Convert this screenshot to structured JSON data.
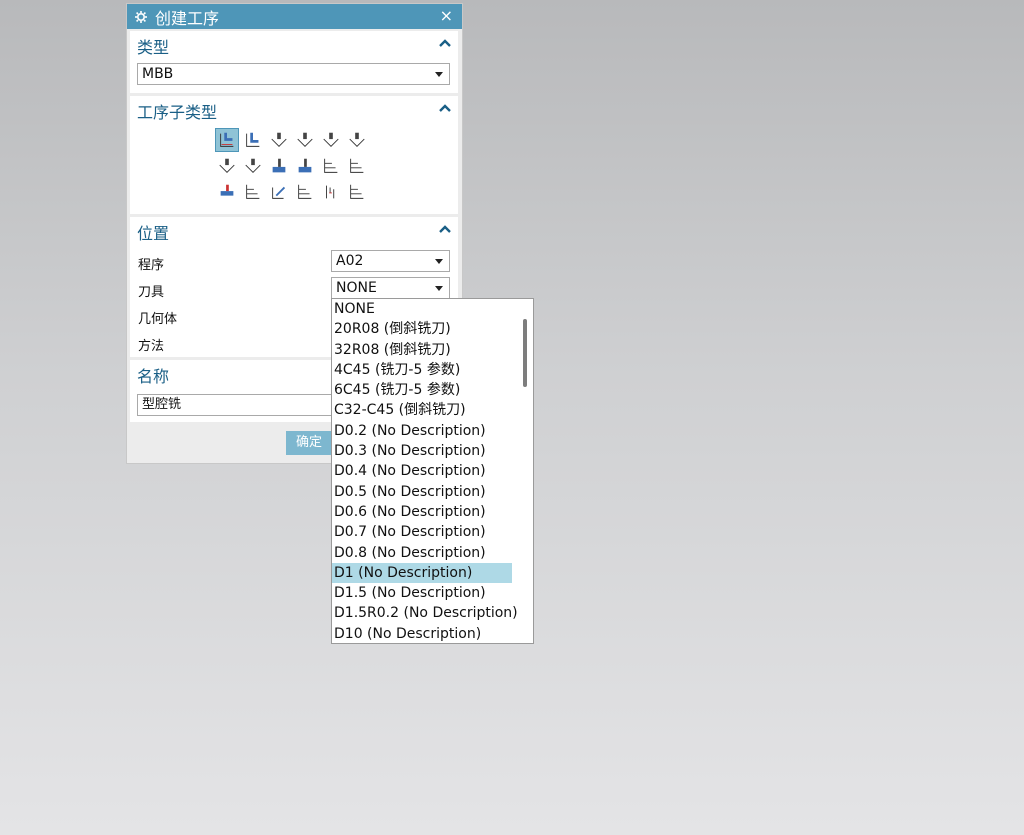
{
  "dialog": {
    "title": "创建工序",
    "close_label": "×",
    "title_icon": "gear-icon"
  },
  "type_section": {
    "heading": "类型",
    "value": "MBB"
  },
  "subtype_section": {
    "heading": "工序子类型",
    "selected_index": 0
  },
  "location_section": {
    "heading": "位置",
    "program_label": "程序",
    "program_value": "A02",
    "tool_label": "刀具",
    "tool_value": "NONE",
    "geometry_label": "几何体",
    "method_label": "方法"
  },
  "name_section": {
    "heading": "名称",
    "value": "型腔铣"
  },
  "buttons": {
    "ok_label": "确定"
  },
  "tool_dropdown": {
    "selected_index": 13,
    "items": [
      "NONE",
      "20R08 (倒斜铣刀)",
      "32R08 (倒斜铣刀)",
      "4C45 (铣刀-5 参数)",
      "6C45 (铣刀-5 参数)",
      "C32-C45 (倒斜铣刀)",
      "D0.2 (No Description)",
      "D0.3 (No Description)",
      "D0.4 (No Description)",
      "D0.5 (No Description)",
      "D0.6 (No Description)",
      "D0.7 (No Description)",
      "D0.8 (No Description)",
      "D1 (No Description)",
      "D1.5 (No Description)",
      "D1.5R0.2 (No Description)",
      "D10 (No Description)"
    ]
  },
  "colors": {
    "title_bar": "#4e96b8",
    "heading_text": "#1a5f86",
    "selected_item": "#aed9e6",
    "ok_button": "#7db7cf"
  }
}
